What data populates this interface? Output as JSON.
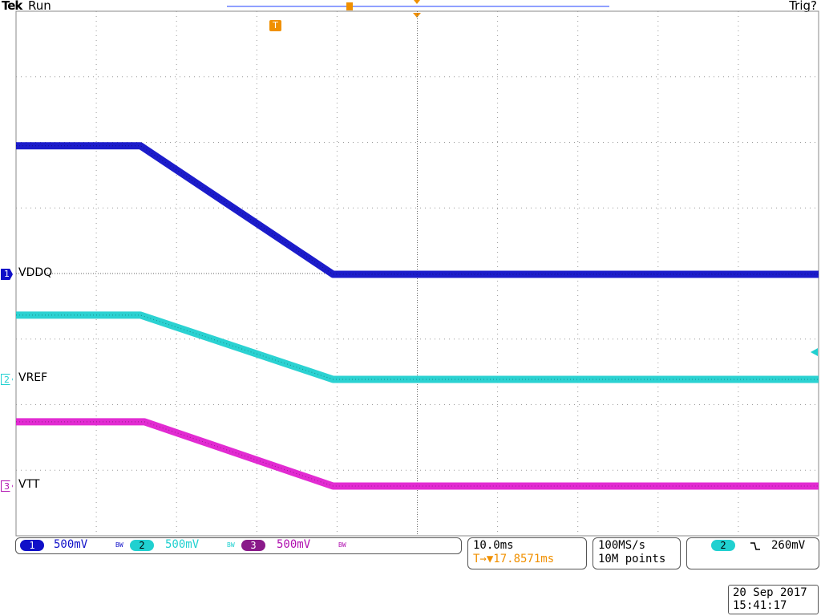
{
  "header": {
    "brand": "Tek",
    "run_state": "Run",
    "trigger_status": "Trig?"
  },
  "markers": {
    "trigger_t": "T",
    "pos_t": "T"
  },
  "channels": [
    {
      "num": "1",
      "name": "VDDQ",
      "scale": "500mV",
      "bw": "BW",
      "color": "#1010c8"
    },
    {
      "num": "2",
      "name": "VREF",
      "scale": "500mV",
      "bw": "BW",
      "color": "#20d0d0"
    },
    {
      "num": "3",
      "name": "VTT",
      "scale": "500mV",
      "bw": "BW",
      "color": "#e020d0"
    }
  ],
  "horizontal": {
    "time_div": "10.0ms",
    "trigger_pos": "T→▼17.8571ms"
  },
  "acquisition": {
    "sample_rate": "100MS/s",
    "record_length": "10M points"
  },
  "trigger": {
    "source": "2",
    "slope_icon": "falling-edge-icon",
    "level": "260mV"
  },
  "timestamp": {
    "date": "20 Sep  2017",
    "time": "15:41:17"
  },
  "colors": {
    "orange": "#f09000",
    "grid": "#888888",
    "record_bar": "#2040ff"
  },
  "waveforms": {
    "time_div_ms": 10,
    "volts_div": 0.5,
    "VDDQ": {
      "high_div_above_ref": 1.96,
      "low_div_above_ref": 0.0,
      "fall_start_div": 1.55,
      "fall_end_div": 3.95
    },
    "VREF": {
      "high_div_above_ref": 0.98,
      "low_div_above_ref": 0.0,
      "fall_start_div": 1.55,
      "fall_end_div": 3.95
    },
    "VTT": {
      "high_div_above_ref": 0.98,
      "low_div_above_ref": 0.0,
      "fall_start_div": 1.6,
      "fall_end_div": 3.95
    }
  }
}
